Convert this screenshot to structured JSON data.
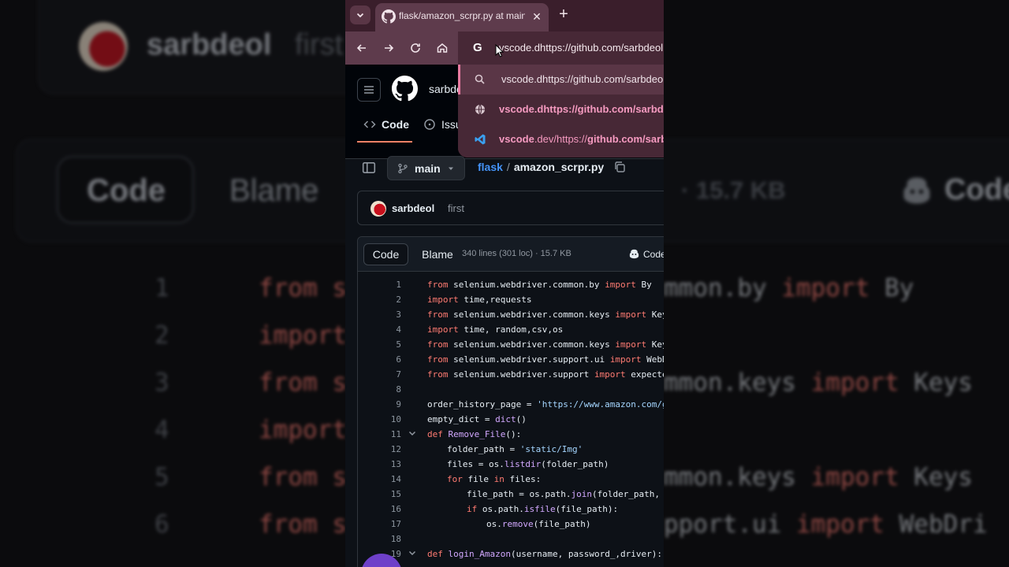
{
  "background": {
    "username": "sarbdeol",
    "commit_msg": "first",
    "code_tab": "Code",
    "blame_tab": "Blame",
    "size": "· 15.7 KB",
    "copilot": "Code",
    "lines": [
      {
        "n": "1",
        "pre": "from s",
        "right_pre": "mmon.by ",
        "right_kw": "import",
        "right_post": " By"
      },
      {
        "n": "2",
        "pre": "import",
        "right_pre": "",
        "right_kw": "",
        "right_post": ""
      },
      {
        "n": "3",
        "pre": "from s",
        "right_pre": "mmon.keys ",
        "right_kw": "import",
        "right_post": " Keys"
      },
      {
        "n": "4",
        "pre": "import",
        "right_pre": "",
        "right_kw": "",
        "right_post": ""
      },
      {
        "n": "5",
        "pre": "from s",
        "right_pre": "mmon.keys ",
        "right_kw": "import",
        "right_post": " Keys"
      },
      {
        "n": "6",
        "pre": "from s",
        "right_pre": "pport.ui ",
        "right_kw": "import",
        "right_post": " WebDri"
      }
    ]
  },
  "browser": {
    "tab_title": "flask/amazon_scrpr.py at main · sarbdeol",
    "tab_close": "✕",
    "new_tab": "+",
    "omnibox_engine": "G",
    "omnibox_text": "vscode.dhttps://github.com/sarbdeol",
    "suggestions": [
      {
        "icon": "search-icon",
        "bold": "",
        "text": "vscode.dhttps://github.com/sarbdeol"
      },
      {
        "icon": "globe-icon",
        "bold": "vscode.dhttps://github.com/sarbdeol",
        "text": ""
      },
      {
        "icon": "vscode-icon",
        "bold": "vscode",
        "text": ".dev/https://",
        "bold2": "github.com/sarbdeol"
      }
    ]
  },
  "github": {
    "username": "sarbde",
    "tabs": [
      {
        "label": "Code"
      },
      {
        "label": "Issu"
      }
    ],
    "branch": "main",
    "repo": "flask",
    "sep": "/",
    "file": "amazon_scrpr.py",
    "commit_user": "sarbdeol",
    "commit_msg": "first",
    "code_seg": "Code",
    "blame_seg": "Blame",
    "meta": "340 lines (301 loc) · 15.7 KB",
    "copilot": "Code",
    "accent": "#f78166",
    "link_color": "#4493f8"
  },
  "code": [
    {
      "n": "1",
      "fold": false,
      "indent": 0,
      "tokens": [
        [
          "kw",
          "from"
        ],
        [
          "t",
          " selenium.webdriver.common.by "
        ],
        [
          "kw",
          "import"
        ],
        [
          "t",
          " By"
        ]
      ]
    },
    {
      "n": "2",
      "fold": false,
      "indent": 0,
      "tokens": [
        [
          "kw",
          "import"
        ],
        [
          "t",
          " time,requests"
        ]
      ]
    },
    {
      "n": "3",
      "fold": false,
      "indent": 0,
      "tokens": [
        [
          "kw",
          "from"
        ],
        [
          "t",
          " selenium.webdriver.common.keys "
        ],
        [
          "kw",
          "import"
        ],
        [
          "t",
          " Keys"
        ]
      ]
    },
    {
      "n": "4",
      "fold": false,
      "indent": 0,
      "tokens": [
        [
          "kw",
          "import"
        ],
        [
          "t",
          " time, random,csv,os"
        ]
      ]
    },
    {
      "n": "5",
      "fold": false,
      "indent": 0,
      "tokens": [
        [
          "kw",
          "from"
        ],
        [
          "t",
          " selenium.webdriver.common.keys "
        ],
        [
          "kw",
          "import"
        ],
        [
          "t",
          " Keys"
        ]
      ]
    },
    {
      "n": "6",
      "fold": false,
      "indent": 0,
      "tokens": [
        [
          "kw",
          "from"
        ],
        [
          "t",
          " selenium.webdriver.support.ui "
        ],
        [
          "kw",
          "import"
        ],
        [
          "t",
          " WebDri"
        ]
      ]
    },
    {
      "n": "7",
      "fold": false,
      "indent": 0,
      "tokens": [
        [
          "kw",
          "from"
        ],
        [
          "t",
          " selenium.webdriver.support "
        ],
        [
          "kw",
          "import"
        ],
        [
          "t",
          " expected_"
        ]
      ]
    },
    {
      "n": "8",
      "fold": false,
      "indent": 0,
      "tokens": []
    },
    {
      "n": "9",
      "fold": false,
      "indent": 0,
      "tokens": [
        [
          "t",
          "order_history_page = "
        ],
        [
          "str",
          "'https://www.amazon.com/gp/"
        ]
      ]
    },
    {
      "n": "10",
      "fold": false,
      "indent": 0,
      "tokens": [
        [
          "t",
          "empty_dict = "
        ],
        [
          "fn",
          "dict"
        ],
        [
          "t",
          "()"
        ]
      ]
    },
    {
      "n": "11",
      "fold": true,
      "indent": 0,
      "tokens": [
        [
          "kw",
          "def"
        ],
        [
          "t",
          " "
        ],
        [
          "fn",
          "Remove_File"
        ],
        [
          "t",
          "():"
        ]
      ]
    },
    {
      "n": "12",
      "fold": false,
      "indent": 1,
      "tokens": [
        [
          "t",
          "folder_path = "
        ],
        [
          "str",
          "'static/Img'"
        ]
      ]
    },
    {
      "n": "13",
      "fold": false,
      "indent": 1,
      "tokens": [
        [
          "t",
          "files = os."
        ],
        [
          "fn",
          "listdir"
        ],
        [
          "t",
          "(folder_path)"
        ]
      ]
    },
    {
      "n": "14",
      "fold": false,
      "indent": 1,
      "tokens": [
        [
          "kw",
          "for"
        ],
        [
          "t",
          " file "
        ],
        [
          "kw",
          "in"
        ],
        [
          "t",
          " files:"
        ]
      ]
    },
    {
      "n": "15",
      "fold": false,
      "indent": 2,
      "tokens": [
        [
          "t",
          "file_path = os.path."
        ],
        [
          "fn",
          "join"
        ],
        [
          "t",
          "(folder_path, fi"
        ]
      ]
    },
    {
      "n": "16",
      "fold": false,
      "indent": 2,
      "tokens": [
        [
          "kw",
          "if"
        ],
        [
          "t",
          " os.path."
        ],
        [
          "fn",
          "isfile"
        ],
        [
          "t",
          "(file_path):"
        ]
      ]
    },
    {
      "n": "17",
      "fold": false,
      "indent": 3,
      "tokens": [
        [
          "t",
          "os."
        ],
        [
          "fn",
          "remove"
        ],
        [
          "t",
          "(file_path)"
        ]
      ]
    },
    {
      "n": "18",
      "fold": false,
      "indent": 0,
      "tokens": []
    },
    {
      "n": "19",
      "fold": true,
      "indent": 0,
      "tokens": [
        [
          "kw",
          "def"
        ],
        [
          "t",
          " "
        ],
        [
          "fn",
          "login_Amazon"
        ],
        [
          "t",
          "(username, password_,driver):"
        ]
      ]
    }
  ]
}
